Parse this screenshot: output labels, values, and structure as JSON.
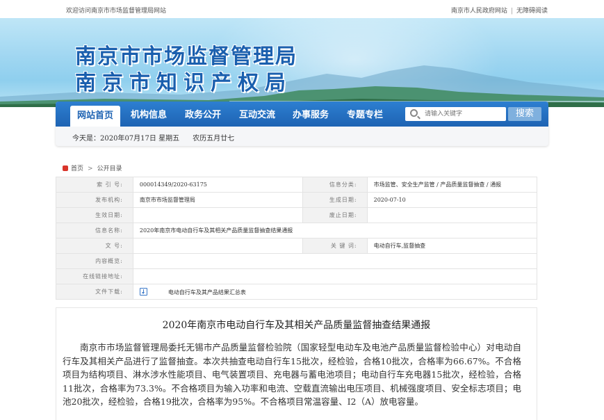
{
  "topbar": {
    "welcome": "欢迎访问南京市市场监督管理局网站",
    "links": [
      "南京市人民政府网站",
      "无障碍阅读"
    ]
  },
  "banner": {
    "title_line1": "南京市市场监督管理局",
    "title_line2": "南京市知识产权局"
  },
  "nav": {
    "items": [
      "网站首页",
      "机构信息",
      "政务公开",
      "互动交流",
      "办事服务",
      "专题专栏"
    ],
    "active_index": 0,
    "search_placeholder": "请输入关键字",
    "search_button": "搜索",
    "colors": {
      "nav_bg": "#1e63b3",
      "search_btn": "#7fb0de"
    }
  },
  "date_line": "今天是：2020年07月17日 星期五      农历五月廿七",
  "breadcrumb": [
    "首页",
    "公开目录"
  ],
  "meta": {
    "index_label": "索 引 号:",
    "index_value": "000014349/2020-63175",
    "category_label": "信息分类:",
    "category_value": "市场监管、安全生产监管 / 产品质量监督抽查 / 通报",
    "publisher_label": "发布机构:",
    "publisher_value": "南京市市场监督管理局",
    "created_label": "生成日期:",
    "created_value": "2020-07-10",
    "effective_label": "生效日期:",
    "effective_value": "",
    "repeal_label": "废止日期:",
    "repeal_value": "",
    "name_label": "信息名称:",
    "name_value": "2020年南京市电动自行车及其相关产品质量监督抽查结果通报",
    "docno_label": "文 号:",
    "docno_value": "",
    "keyword_label": "关 键 词:",
    "keyword_value": "电动自行车,监督抽查",
    "summary_label": "内容概览:",
    "summary_value": "",
    "link_label": "在线链接地址:",
    "link_value": "",
    "download_label": "文件下载:",
    "download_value": "电动自行车及其产品结果汇总表"
  },
  "article": {
    "title": "2020年南京市电动自行车及其相关产品质量监督抽查结果通报",
    "body": "南京市市场监督管理局委托无锡市产品质量监督检验院（国家轻型电动车及电池产品质量监督检验中心）对电动自行车及其相关产品进行了监督抽查。本次共抽查电动自行车15批次，经检验，合格10批次，合格率为66.67%。不合格项目为结构项目、淋水涉水性能项目、电气装置项目、充电器与蓄电池项目；电动自行车充电器15批次，经检验，合格11批次，合格率为73.3%。不合格项目为输入功率和电流、空载直流输出电压项目、机械强度项目、安全标志项目；电池20批次，经检验，合格19批次，合格率为95%。不合格项目常温容量、I2（A）放电容量。"
  }
}
